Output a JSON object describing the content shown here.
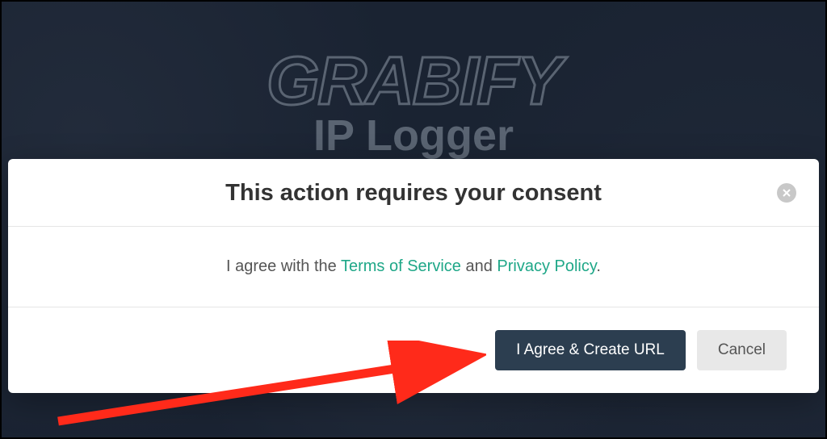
{
  "brand": {
    "title": "GRABIFY",
    "subtitle": "IP Logger"
  },
  "modal": {
    "title": "This action requires your consent",
    "body": {
      "prefix": "I agree with the ",
      "tos_label": "Terms of Service",
      "and": " and ",
      "privacy_label": "Privacy Policy",
      "suffix": "."
    },
    "buttons": {
      "agree": "I Agree & Create URL",
      "cancel": "Cancel"
    }
  },
  "colors": {
    "link": "#1fa788",
    "primary_btn": "#2c3e50",
    "background": "#1a2332"
  }
}
